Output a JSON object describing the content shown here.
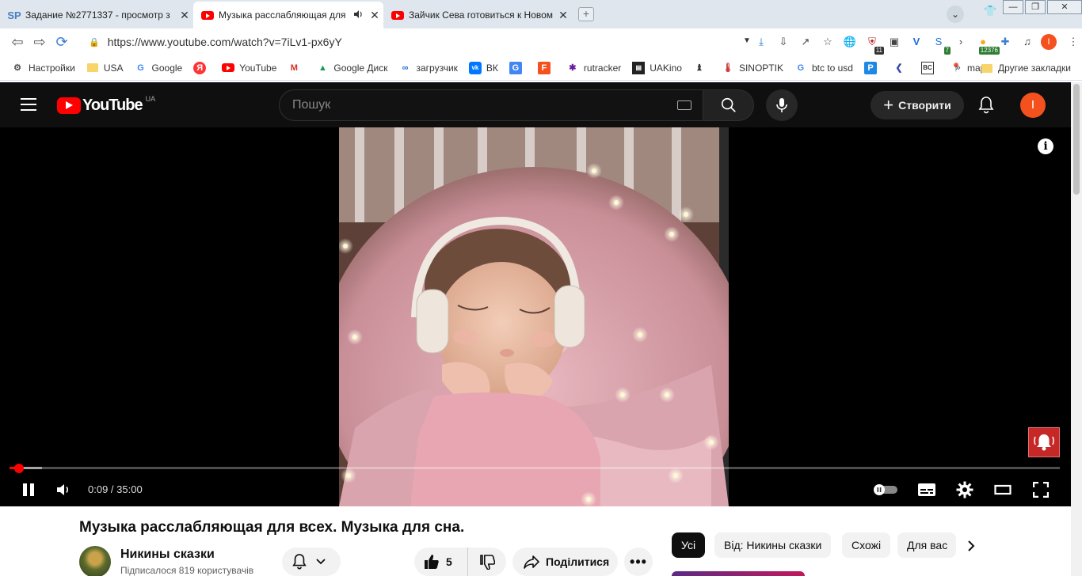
{
  "tabs": [
    {
      "favicon": "sp-icon",
      "favicon_text": "SP",
      "title": "Задание №2771337 - просмотр з",
      "active": false
    },
    {
      "favicon": "youtube-icon",
      "title": "Музыка расслабляющая для",
      "active": true,
      "audio": true
    },
    {
      "favicon": "youtube-icon",
      "title": "Зайчик Сева готовиться к Новом",
      "active": false
    }
  ],
  "address_bar": {
    "url": "https://www.youtube.com/watch?v=7iLv1-px6yY"
  },
  "extensions": {
    "badge_1": "11",
    "badge_2": "7",
    "badge_3": "12376",
    "profile_letter": "I"
  },
  "bookmarks": [
    {
      "label": "Настройки",
      "icon": "gear-icon"
    },
    {
      "label": "USA",
      "icon": "folder-icon"
    },
    {
      "label": "Google",
      "icon": "google-icon"
    },
    {
      "label": "",
      "icon": "yandex-icon"
    },
    {
      "label": "YouTube",
      "icon": "youtube-icon"
    },
    {
      "label": "",
      "icon": "gmail-icon"
    },
    {
      "label": "Google Диск",
      "icon": "drive-icon"
    },
    {
      "label": "загрузчик",
      "icon": "infinity-icon"
    },
    {
      "label": "ВК",
      "icon": "vk-icon"
    },
    {
      "label": "",
      "icon": "translate-icon"
    },
    {
      "label": "",
      "icon": "f-icon"
    },
    {
      "label": "rutracker",
      "icon": "rutracker-icon"
    },
    {
      "label": "UAKino",
      "icon": "film-icon"
    },
    {
      "label": "",
      "icon": "chess-icon"
    },
    {
      "label": "SINOPTIK",
      "icon": "thermometer-icon"
    },
    {
      "label": "btc to usd",
      "icon": "google-icon"
    },
    {
      "label": "",
      "icon": "p-icon"
    },
    {
      "label": "",
      "icon": "arrow-icon"
    },
    {
      "label": "",
      "icon": "bc-icon"
    },
    {
      "label": "maps",
      "icon": "maps-icon"
    }
  ],
  "bookmarks_overflow": "»",
  "bookmarks_other": "Другие закладки",
  "youtube": {
    "logo_text": "YouTube",
    "region": "UA",
    "search_placeholder": "Пошук",
    "create_label": "Створити",
    "avatar_letter": "I"
  },
  "player": {
    "time_current": "0:09",
    "time_total": "35:00",
    "time_display": "0:09 / 35:00",
    "progress": 0.0043,
    "buffered": 0.031
  },
  "video": {
    "title": "Музыка расслабляющая для всех. Музыка для сна.",
    "channel_name": "Никины сказки",
    "subscribers": "Підписалося 819 користувачів",
    "likes": "5",
    "share_label": "Поділитися"
  },
  "chips": [
    "Усі",
    "Від: Никины сказки",
    "Схожі",
    "Для вас"
  ],
  "colors": {
    "youtube_red": "#ff0000",
    "header_bg": "#0f0f0f",
    "avatar_orange": "#f4511e"
  }
}
